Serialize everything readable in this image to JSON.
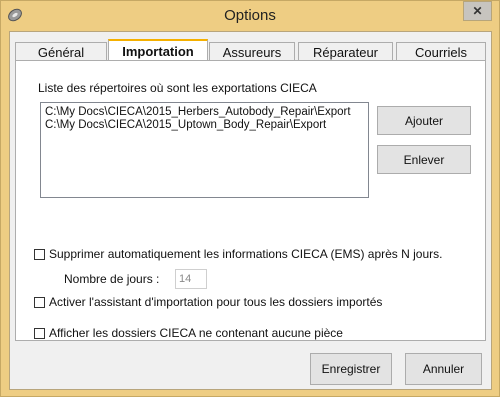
{
  "window": {
    "title": "Options",
    "close_label": "✕"
  },
  "tabs": [
    {
      "label": "Général"
    },
    {
      "label": "Importation"
    },
    {
      "label": "Assureurs"
    },
    {
      "label": "Réparateur"
    },
    {
      "label": "Courriels"
    }
  ],
  "selected_tab": "Importation",
  "importation": {
    "list_label": "Liste des répertoires où sont les exportations CIECA",
    "directories": [
      "C:\\My Docs\\CIECA\\2015_Herbers_Autobody_Repair\\Export",
      "C:\\My Docs\\CIECA\\2015_Uptown_Body_Repair\\Export"
    ],
    "add_button": "Ajouter",
    "remove_button": "Enlever",
    "auto_delete_label": "Supprimer automatiquement les informations CIECA (EMS) après N jours.",
    "days_label": "Nombre de jours :",
    "days_value": "14",
    "activate_assistant_label": "Activer l'assistant d'importation pour tous les dossiers importés",
    "show_folders_label": "Afficher les dossiers CIECA ne contenant aucune pièce"
  },
  "footer": {
    "save_button": "Enregistrer",
    "cancel_button": "Annuler"
  },
  "colors": {
    "titlebar": "#eecd83",
    "selected_tab_accent": "#f5b000"
  }
}
